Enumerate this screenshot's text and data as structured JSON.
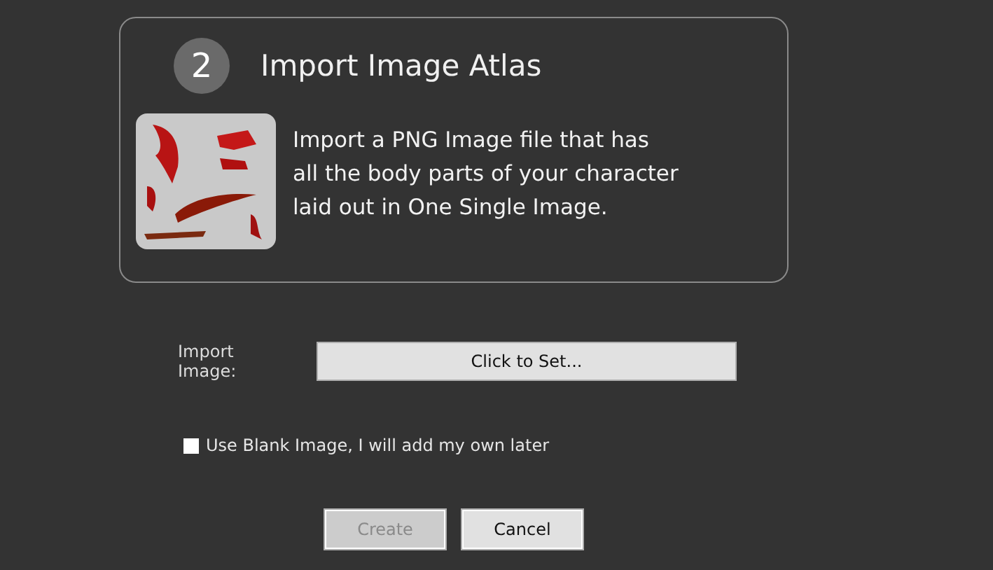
{
  "header": {
    "step": "2",
    "title": "Import Image Atlas",
    "description": [
      "Import a PNG Image file that has",
      "all the body parts of your character",
      "laid out in One Single Image."
    ]
  },
  "import_image": {
    "label": "Import Image:",
    "button": "Click to Set..."
  },
  "blank_image": {
    "label": "Use Blank Image, I will add my own later",
    "checked": false
  },
  "buttons": [
    {
      "label": "Create",
      "disabled": true
    },
    {
      "label": "Cancel",
      "disabled": false
    }
  ]
}
